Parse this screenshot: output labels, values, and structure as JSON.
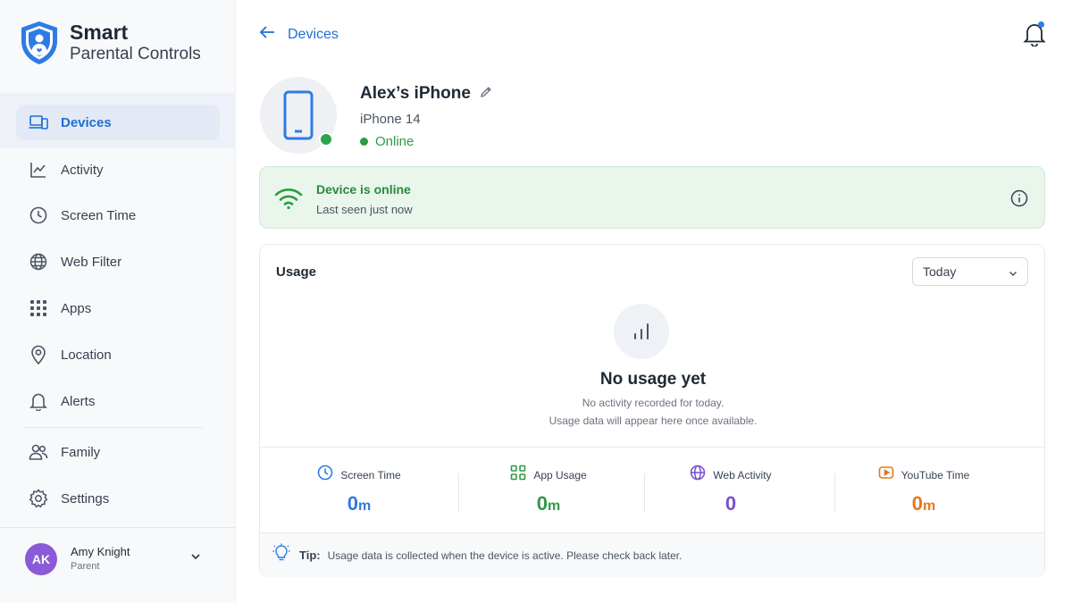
{
  "brand": {
    "title": "Smart",
    "subtitle": "Parental Controls",
    "logo_icon": "shield-person-icon"
  },
  "sidebar": {
    "items": [
      {
        "label": "Devices",
        "icon": "laptop-phone-icon",
        "active": true
      },
      {
        "label": "Activity",
        "icon": "line-chart-icon",
        "active": false
      },
      {
        "label": "Screen Time",
        "icon": "clock-icon",
        "active": false
      },
      {
        "label": "Web Filter",
        "icon": "globe-shield-icon",
        "active": false
      },
      {
        "label": "Apps",
        "icon": "grid-icon",
        "active": false
      },
      {
        "label": "Location",
        "icon": "map-pin-icon",
        "active": false
      },
      {
        "label": "Alerts",
        "icon": "bell-icon",
        "active": false
      },
      {
        "label": "Family",
        "icon": "people-icon",
        "active": false
      },
      {
        "label": "Settings",
        "icon": "gear-icon",
        "active": false
      }
    ]
  },
  "profile": {
    "initials": "AK",
    "name": "Amy Knight",
    "role": "Parent"
  },
  "header": {
    "back_label": "Devices"
  },
  "device": {
    "name": "Alex’s iPhone",
    "model": "iPhone 14",
    "status": "Online"
  },
  "banner": {
    "title": "Device is online",
    "subtitle": "Last seen just now"
  },
  "usage": {
    "title": "Usage",
    "period": "Today",
    "empty_title": "No usage yet",
    "empty_line1": "No activity recorded for today.",
    "empty_line2": "Usage data will appear here once available.",
    "stats": [
      {
        "label": "Screen Time",
        "value": "0",
        "unit": "m",
        "color": "#2f7be5",
        "icon": "clock-icon"
      },
      {
        "label": "App Usage",
        "value": "0",
        "unit": "m",
        "color": "#2e9b46",
        "icon": "grid-icon"
      },
      {
        "label": "Web Activity",
        "value": "0",
        "unit": "",
        "color": "#7b4fc9",
        "icon": "globe-icon"
      },
      {
        "label": "YouTube Time",
        "value": "0",
        "unit": "m",
        "color": "#e07a1f",
        "icon": "play-icon"
      }
    ]
  },
  "tip": {
    "label": "Tip:",
    "text": "Usage data is collected when the device is active. Please check back later."
  },
  "colors": {
    "accent": "#1f6fd1",
    "online": "#2e9b46"
  }
}
